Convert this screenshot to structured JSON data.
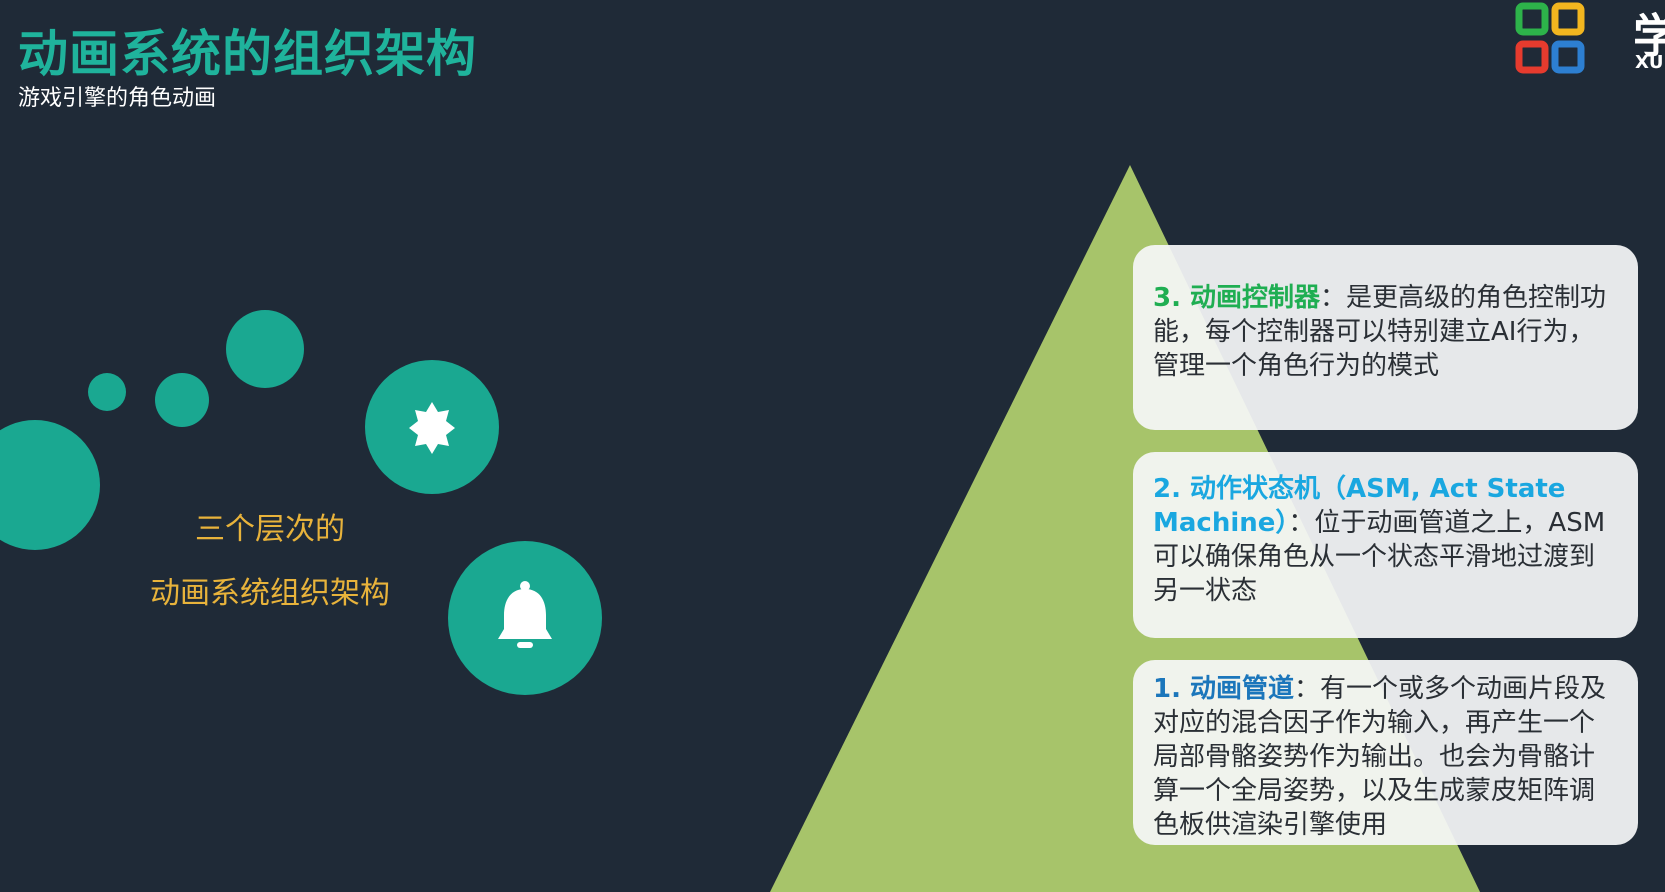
{
  "header": {
    "title": "动画系统的组织架构",
    "subtitle": "游戏引擎的角色动画"
  },
  "logo": {
    "char": "学",
    "sub": "XU",
    "colors": [
      "#2db34a",
      "#f2b61f",
      "#e63b2e",
      "#2d7fd1"
    ]
  },
  "left": {
    "caption_line1": "三个层次的",
    "caption_line2": "动画系统组织架构",
    "bubble_color": "#1aa891",
    "caption_color": "#e8b33b",
    "icons": [
      "badge-icon",
      "bell-icon"
    ]
  },
  "pyramid": {
    "color": "#a7c46a",
    "cards": [
      {
        "lead": "3. 动画控制器",
        "text": "：是更高级的角色控制功能，每个控制器可以特别建立AI行为，管理一个角色行为的模式",
        "lead_color": "#1fae52"
      },
      {
        "lead": "2. 动作状态机（ASM, Act State Machine）",
        "text": "：位于动画管道之上，ASM可以确保角色从一个状态平滑地过渡到另一状态",
        "lead_color": "#1aa7e0"
      },
      {
        "lead": "1. 动画管道",
        "text": "：有一个或多个动画片段及对应的混合因子作为输入，再产生一个局部骨骼姿势作为输出。也会为骨骼计算一个全局姿势，以及生成蒙皮矩阵调色板供渲染引擎使用",
        "lead_color": "#1b76bb"
      }
    ]
  }
}
